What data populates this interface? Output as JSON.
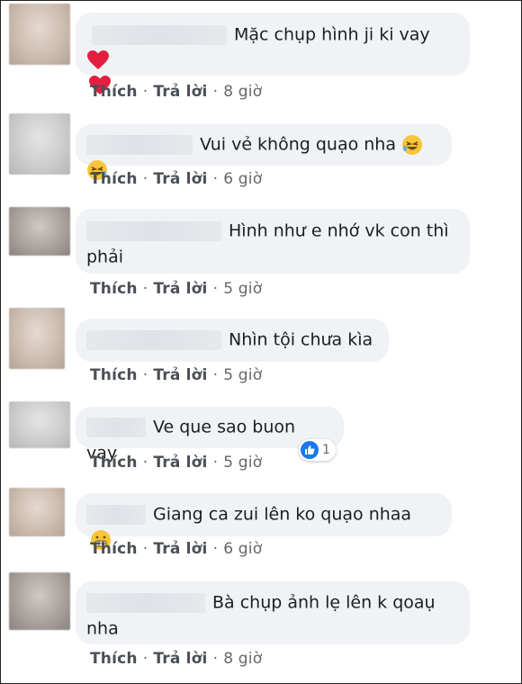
{
  "labels": {
    "like": "Thích",
    "reply": "Trả lời",
    "dot": "·"
  },
  "comments": [
    {
      "text": "Mặc chụp hình ji ki vay",
      "time": "8 giờ",
      "emoji": "heart-icon"
    },
    {
      "text": "Vui vẻ không quạo nha",
      "time": "6 giờ",
      "emoji": "rofl-icon"
    },
    {
      "text": "Hình như e nhớ vk con thì phải",
      "time": "5 giờ"
    },
    {
      "text": "Nhìn tội chưa kìa",
      "time": "5 giờ"
    },
    {
      "text": "Ve que sao buon vay",
      "time": "5 giờ",
      "reaction_count": "1"
    },
    {
      "text": "Giang ca zui lên ko quạo nhaa",
      "time": "6 giờ",
      "emoji": "grimace-icon"
    },
    {
      "text": "Bà chụp ảnh lẹ lên k qoaụ nha",
      "time": "8 giờ"
    }
  ],
  "colors": {
    "bubble": "#f0f2f5",
    "action": "#65676b",
    "like_blue": "#1877f2",
    "heart": "#e41e3f"
  }
}
